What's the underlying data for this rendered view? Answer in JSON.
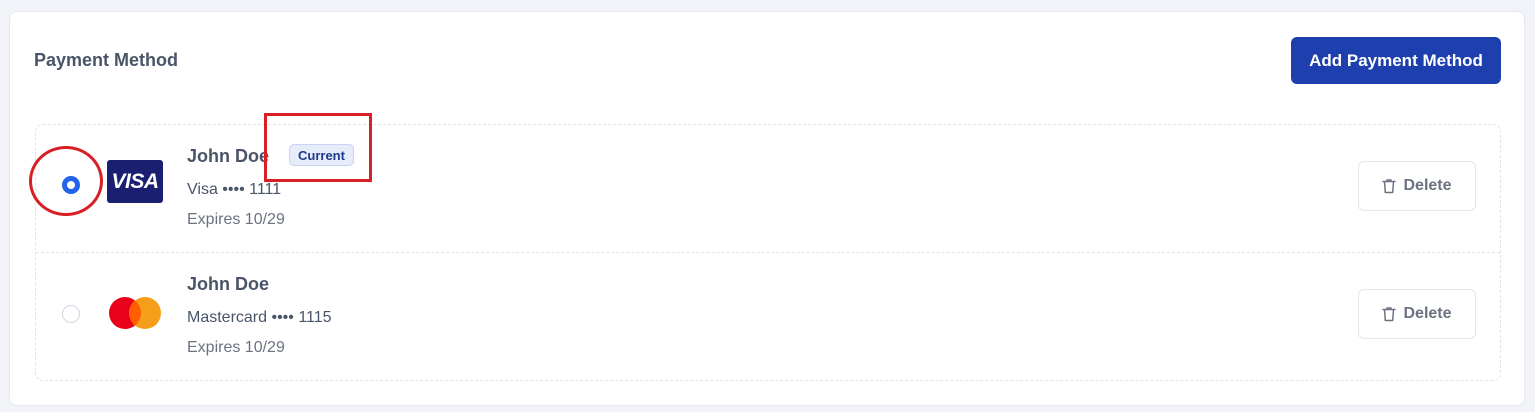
{
  "section": {
    "title": "Payment Method",
    "add_button_label": "Add Payment Method"
  },
  "methods": [
    {
      "brand": "VISA",
      "holder": "John Doe",
      "badge": "Current",
      "card_line": "Visa •••• 1111",
      "expires": "Expires 10/29",
      "selected": true,
      "delete_label": "Delete"
    },
    {
      "brand": "mastercard",
      "holder": "John Doe",
      "card_line": "Mastercard •••• 1115",
      "expires": "Expires 10/29",
      "selected": false,
      "delete_label": "Delete"
    }
  ],
  "colors": {
    "primary": "#1e40af",
    "radio_selected": "#2563eb",
    "annotation": "#d91f26",
    "visa_brand": "#1a1f71",
    "mc_red": "#eb001b",
    "mc_orange": "#f79e1b"
  },
  "icons": {
    "delete": "trash-icon"
  }
}
